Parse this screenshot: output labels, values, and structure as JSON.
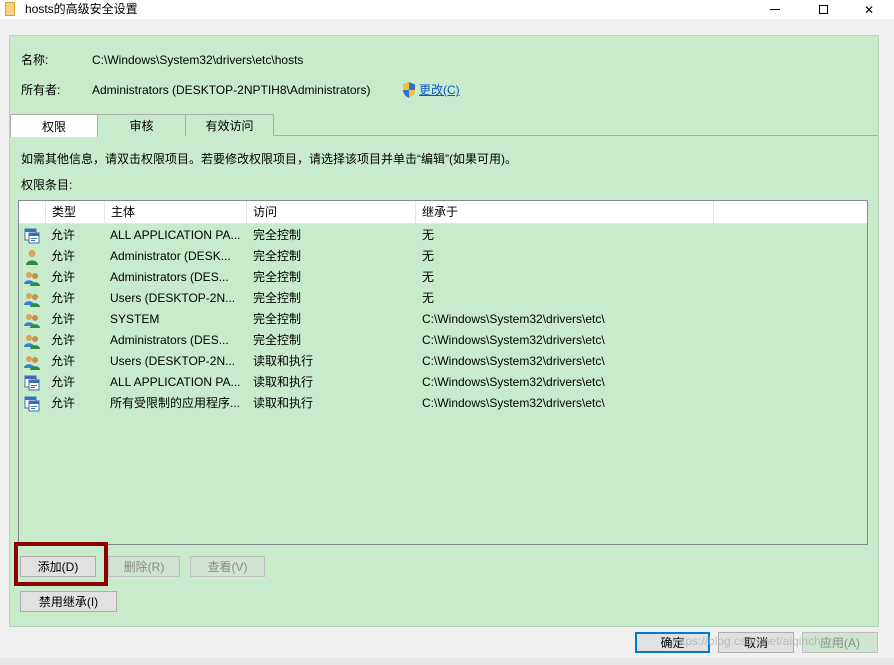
{
  "window": {
    "title": "hosts的高级安全设置"
  },
  "info": {
    "name_label": "名称:",
    "name_value": "C:\\Windows\\System32\\drivers\\etc\\hosts",
    "owner_label": "所有者:",
    "owner_value": "Administrators (DESKTOP-2NPTIH8\\Administrators)",
    "change_link": "更改(C)"
  },
  "tabs": [
    {
      "label": "权限",
      "active": true
    },
    {
      "label": "审核",
      "active": false
    },
    {
      "label": "有效访问",
      "active": false
    }
  ],
  "instructions": "如需其他信息，请双击权限项目。若要修改权限项目，请选择该项目并单击“编辑”(如果可用)。",
  "entries_label": "权限条目:",
  "columns": [
    "类型",
    "主体",
    "访问",
    "继承于"
  ],
  "rows": [
    {
      "icon": "app-package-icon",
      "type": "允许",
      "principal": "ALL APPLICATION PA...",
      "access": "完全控制",
      "inherited": "无"
    },
    {
      "icon": "user-icon",
      "type": "允许",
      "principal": "Administrator (DESK...",
      "access": "完全控制",
      "inherited": "无"
    },
    {
      "icon": "group-icon",
      "type": "允许",
      "principal": "Administrators (DES...",
      "access": "完全控制",
      "inherited": "无"
    },
    {
      "icon": "group-icon",
      "type": "允许",
      "principal": "Users (DESKTOP-2N...",
      "access": "完全控制",
      "inherited": "无"
    },
    {
      "icon": "group-icon",
      "type": "允许",
      "principal": "SYSTEM",
      "access": "完全控制",
      "inherited": "C:\\Windows\\System32\\drivers\\etc\\"
    },
    {
      "icon": "group-icon",
      "type": "允许",
      "principal": "Administrators (DES...",
      "access": "完全控制",
      "inherited": "C:\\Windows\\System32\\drivers\\etc\\"
    },
    {
      "icon": "group-icon",
      "type": "允许",
      "principal": "Users (DESKTOP-2N...",
      "access": "读取和执行",
      "inherited": "C:\\Windows\\System32\\drivers\\etc\\"
    },
    {
      "icon": "app-package-icon",
      "type": "允许",
      "principal": "ALL APPLICATION PA...",
      "access": "读取和执行",
      "inherited": "C:\\Windows\\System32\\drivers\\etc\\"
    },
    {
      "icon": "app-package-icon",
      "type": "允许",
      "principal": "所有受限制的应用程序...",
      "access": "读取和执行",
      "inherited": "C:\\Windows\\System32\\drivers\\etc\\"
    }
  ],
  "buttons": {
    "add": "添加(D)",
    "remove": "删除(R)",
    "view": "查看(V)",
    "disable_inheritance": "禁用继承(I)",
    "ok": "确定",
    "cancel": "取消",
    "apply": "应用(A)"
  },
  "watermark": "https://blog.csdn.net/aiqinchao",
  "colors": {
    "panel_bg": "#c8ebcc",
    "highlight": "#8b0000",
    "link": "#0b57c9"
  }
}
